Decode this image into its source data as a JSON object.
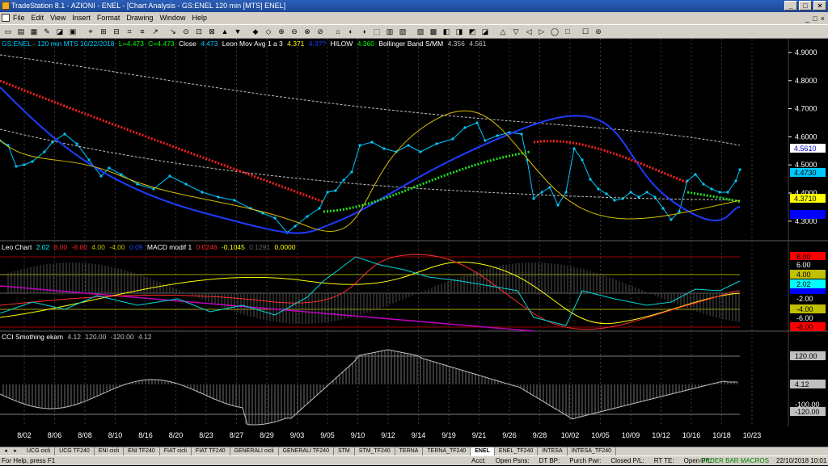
{
  "window": {
    "title": "TradeStation 8.1 - AZIONI - ENEL - [Chart Analysis - GS:ENEL  120 min  [MTS] ENEL]",
    "buttons": [
      "_",
      "□",
      "×"
    ]
  },
  "menu": {
    "items": [
      "File",
      "Edit",
      "View",
      "Insert",
      "Format",
      "Drawing",
      "Window",
      "Help"
    ],
    "mdi_buttons": [
      "_",
      "□",
      "×"
    ]
  },
  "chart_info": {
    "symbol_line": "GS:ENEL - 120 min   MTS  10/22/2018",
    "low": "L=4.473",
    "close_val": "C=4.473",
    "close_label": "Close",
    "close_value": "4.473",
    "leon_label": "Leon Mov Avg 1 a 3",
    "leon_value1": "4.371",
    "leon_value2": "4.3??",
    "hilow_label": "HILOW",
    "hilow_value": "4.360",
    "bb_label": "Bollinger Band S/MM",
    "bb_value1": "4.356",
    "bb_value2": "4.561"
  },
  "leo_info": {
    "label": "Leo Chart",
    "v1": "2.02",
    "v2": "8.00",
    "v3": "-8.00",
    "v4": "4.00",
    "v5": "-4.00",
    "v6": "0.09",
    "macd_label": "MACD modif 1",
    "m1": "0.0246",
    "m2": "-0.1045",
    "m3": "0.1291",
    "m4": "0.0000"
  },
  "cci_info": {
    "label": "CCI Smothing ekam",
    "v1": "4.12",
    "v2": "120.00",
    "v3": "-120.00",
    "v4": "4.12"
  },
  "price_axis": {
    "ticks": [
      "4.9000",
      "4.8000",
      "4.7000",
      "4.6000",
      "4.5000",
      "4.4000",
      "4.3000"
    ],
    "badges": [
      {
        "text": "4.5610",
        "bg": "#ffffff",
        "fg": "#0000c0"
      },
      {
        "text": "4.4730",
        "bg": "#00c8ff",
        "fg": "#000000"
      },
      {
        "text": "4.3710",
        "bg": "#ffff00",
        "fg": "#000000"
      },
      {
        "text": "4.3..",
        "bg": "#0000ff",
        "fg": "#0000ff"
      }
    ]
  },
  "leo_axis": {
    "badges": [
      {
        "text": "8.00",
        "bg": "#ff0000",
        "fg": "#000000"
      },
      {
        "text": "6.00",
        "bg": "#000000",
        "fg": "#ffffff"
      },
      {
        "text": "4.00",
        "bg": "#c0c000",
        "fg": "#000000"
      },
      {
        "text": "2.02",
        "bg": "#00ffff",
        "fg": "#000000"
      },
      {
        "text": "",
        "bg": "#0000ff",
        "fg": "#0000ff"
      },
      {
        "text": "-2.00",
        "bg": "#000000",
        "fg": "#ffffff"
      },
      {
        "text": "-4.00",
        "bg": "#c0c000",
        "fg": "#000000"
      },
      {
        "text": "-6.00",
        "bg": "#000000",
        "fg": "#ffffff"
      },
      {
        "text": "-8.00",
        "bg": "#ff0000",
        "fg": "#000000"
      }
    ]
  },
  "cci_axis": {
    "badges": [
      {
        "text": "120.00",
        "bg": "#c0c0c0",
        "fg": "#000000"
      },
      {
        "text": "4.12",
        "bg": "#c0c0c0",
        "fg": "#000000"
      },
      {
        "text": "-100.00",
        "bg": "#000000",
        "fg": "#ffffff"
      },
      {
        "text": "-120.00",
        "bg": "#c0c0c0",
        "fg": "#000000"
      }
    ]
  },
  "date_axis": [
    "8/02",
    "8/06",
    "8/08",
    "8/10",
    "8/16",
    "8/20",
    "8/23",
    "8/27",
    "8/29",
    "9/03",
    "9/05",
    "9/10",
    "9/12",
    "9/14",
    "9/19",
    "9/21",
    "9/26",
    "9/28",
    "10/02",
    "10/05",
    "10/09",
    "10/12",
    "10/16",
    "10/18",
    "10/23"
  ],
  "tabs": {
    "items": [
      "UCG cicli",
      "UCG TF240",
      "ENI cicli",
      "ENI TF240",
      "FIAT cicli",
      "FIAT TF240",
      "GENERALI cicli",
      "GENERALI TF240",
      "STM",
      "STM_TF240",
      "TERNA",
      "TERNA_TF240",
      "ENEL",
      "ENEL_TF240",
      "INTESA",
      "INTESA_TF240"
    ],
    "active_index": 12
  },
  "status": {
    "help": "For Help, press F1",
    "fields": [
      "Acct:",
      "Open Psns:",
      "DT BP:",
      "Purch Pwr:",
      "Closed P/L:",
      "RT TE:",
      "Open P/L:"
    ],
    "order_macros": "ORDER BAR  MACROS",
    "datetime": "22/10/2018 10:01"
  },
  "colors": {
    "price": "#00c8ff",
    "ma_blue": "#1e3cff",
    "ma_red": "#ff2020",
    "ma_green": "#20e020",
    "bb_yellow": "#d4c000",
    "bb_gray": "#c0c0c0"
  }
}
